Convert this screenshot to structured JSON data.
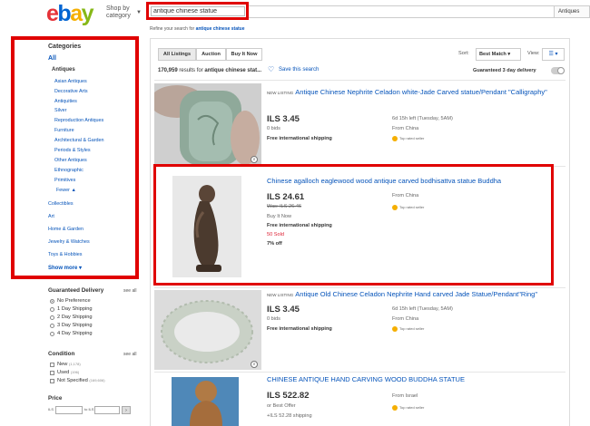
{
  "header": {
    "logo_letters": [
      "e",
      "b",
      "a",
      "y"
    ],
    "shop_by_category": "Shop by category",
    "search_value": "antique chinese statue",
    "category_dropdown": "Antiques",
    "refine_prefix": "Refine your search for",
    "refine_query": "antique chinese statue"
  },
  "sidebar": {
    "categories_title": "Categories",
    "all_label": "All",
    "antiques_label": "Antiques",
    "subcategories": [
      "Asian Antiques",
      "Decorative Arts",
      "Antiquities",
      "Silver",
      "Reproduction Antiques",
      "Furniture",
      "Architectural & Garden",
      "Periods & Styles",
      "Other Antiques",
      "Ethnographic",
      "Primitives",
      "Fewer ▲"
    ],
    "other_categories": [
      "Collectibles",
      "Art",
      "Home & Garden",
      "Jewelry & Watches",
      "Toys & Hobbies"
    ],
    "show_more": "Show more ▾",
    "guaranteed_delivery": {
      "title": "Guaranteed Delivery",
      "see_all": "see all",
      "options": [
        "No Preference",
        "1 Day Shipping",
        "2 Day Shipping",
        "3 Day Shipping",
        "4 Day Shipping"
      ],
      "selected_index": 0
    },
    "condition": {
      "title": "Condition",
      "see_all": "see all",
      "options": [
        {
          "label": "New",
          "count": "(1,178)"
        },
        {
          "label": "Used",
          "count": "(196)"
        },
        {
          "label": "Not Specified",
          "count": "(169,606)"
        }
      ]
    },
    "price": {
      "title": "Price",
      "min_label": "ILS",
      "max_label": "to ILS"
    }
  },
  "results_header": {
    "tabs": [
      "All Listings",
      "Auction",
      "Buy It Now"
    ],
    "active_tab": 0,
    "result_count": "170,959",
    "results_for": "results for",
    "query_short": "antique chinese stat...",
    "save_search": "Save this search",
    "sort_label": "Sort:",
    "sort_value": "Best Match",
    "view_label": "View:",
    "guaranteed_toggle": "Guaranteed 3 day delivery"
  },
  "listings": [
    {
      "new_listing": "New listing",
      "title": "Antique Chinese Nephrite Celadon white-Jade Carved statue/Pendant \"Calligraphy\"",
      "price": "ILS 3.45",
      "bids": "0 bids",
      "shipping": "Free international shipping",
      "time_left": "6d 15h left (Tuesday, 5AM)",
      "location": "From China",
      "seller_badge": "Top rated seller"
    },
    {
      "title": "Chinese agalloch eaglewood wood antique carved bodhisattva statue Buddha",
      "price": "ILS 24.61",
      "was": "Was: ILS 26.46",
      "buy_it_now": "Buy It Now",
      "shipping": "Free international shipping",
      "sold": "50 Sold",
      "discount": "7% off",
      "location": "From China",
      "seller_badge": "Top rated seller"
    },
    {
      "new_listing": "New listing",
      "title": "Antique Old Chinese Celadon Nephrite Hand carved Jade Statue/Pendant\"Ring\"",
      "price": "ILS 3.45",
      "bids": "0 bids",
      "shipping": "Free international shipping",
      "time_left": "6d 15h left (Tuesday, 5AM)",
      "location": "From China",
      "seller_badge": "Top rated seller"
    },
    {
      "title": "CHINESE ANTIQUE HAND CARVING WOOD BUDDHA STATUE",
      "price": "ILS 522.82",
      "best_offer": "or Best Offer",
      "shipping": "+ILS 52.28 shipping",
      "location": "From Israel",
      "seller_badge": "Top rated seller"
    }
  ],
  "colors": {
    "highlight": "#e00000",
    "link": "#0654ba"
  }
}
